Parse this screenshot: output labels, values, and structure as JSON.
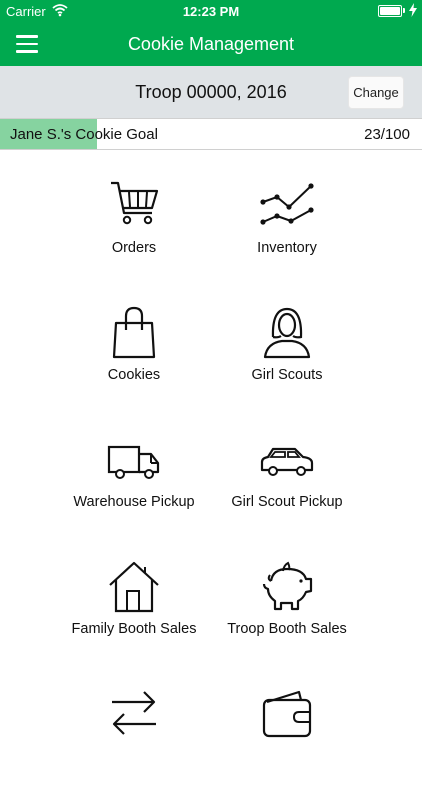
{
  "status_bar": {
    "carrier": "Carrier",
    "time": "12:23 PM"
  },
  "nav": {
    "title": "Cookie Management"
  },
  "troop": {
    "name": "Troop 00000, 2016",
    "change_label": "Change"
  },
  "goal": {
    "label": "Jane S.'s Cookie Goal",
    "count_text": "23/100",
    "sold": 23,
    "target": 100
  },
  "tiles": [
    {
      "label": "Orders",
      "icon": "shopping-cart-icon"
    },
    {
      "label": "Inventory",
      "icon": "line-chart-icon"
    },
    {
      "label": "Cookies",
      "icon": "shopping-bag-icon"
    },
    {
      "label": "Girl Scouts",
      "icon": "girl-person-icon"
    },
    {
      "label": "Warehouse Pickup",
      "icon": "truck-icon"
    },
    {
      "label": "Girl Scout Pickup",
      "icon": "car-icon"
    },
    {
      "label": "Family Booth Sales",
      "icon": "house-icon"
    },
    {
      "label": "Troop Booth Sales",
      "icon": "piggy-bank-icon"
    },
    {
      "label": "",
      "icon": "transfer-arrows-icon"
    },
    {
      "label": "",
      "icon": "wallet-icon"
    }
  ],
  "colors": {
    "brand": "#00a94f",
    "goal_fill": "#86d3a0",
    "troop_bar": "#dfe3e6"
  }
}
